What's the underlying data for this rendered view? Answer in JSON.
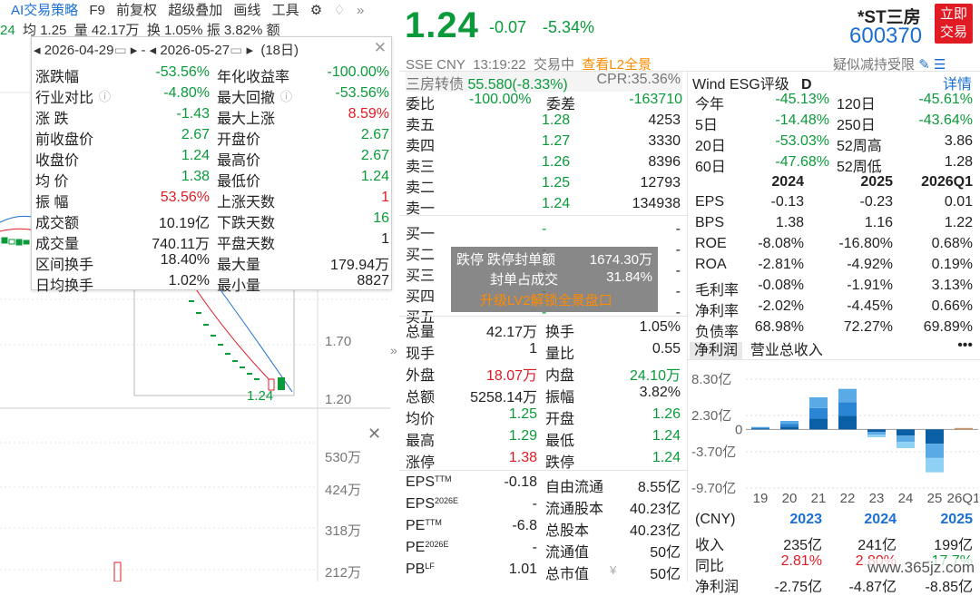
{
  "toolbar": {
    "ai_label": "AI交易策略",
    "f9": "F9",
    "prev_adj": "前复权",
    "overlay": "超级叠加",
    "draw": "画线",
    "tools": "工具"
  },
  "ticker_strip": {
    "price_prefix": "24",
    "avg": "均 1.25",
    "vol": "量 42.17万",
    "turnover": "换 1.05%",
    "amp": "振 3.82%",
    "amt": "额"
  },
  "range_popup": {
    "start": "2026-04-29",
    "end": "2026-05-27",
    "days": "(18日)",
    "rows": [
      {
        "l1": "涨跌幅",
        "v1": "-53.56%",
        "c1": "green",
        "l2": "年化收益率",
        "v2": "-100.00%",
        "c2": "green",
        "h1": false,
        "h2": false
      },
      {
        "l1": "行业对比",
        "v1": "-4.80%",
        "c1": "green",
        "l2": "最大回撤",
        "v2": "-53.56%",
        "c2": "green",
        "h1": true,
        "h2": true
      },
      {
        "l1": "涨  跌",
        "v1": "-1.43",
        "c1": "green",
        "l2": "最大上涨",
        "v2": "8.59%",
        "c2": "red",
        "h1": false,
        "h2": false
      },
      {
        "l1": "前收盘价",
        "v1": "2.67",
        "c1": "green",
        "l2": "开盘价",
        "v2": "2.67",
        "c2": "green",
        "h1": false,
        "h2": false
      },
      {
        "l1": "收盘价",
        "v1": "1.24",
        "c1": "green",
        "l2": "最高价",
        "v2": "2.67",
        "c2": "green",
        "h1": false,
        "h2": false
      },
      {
        "l1": "均  价",
        "v1": "1.38",
        "c1": "green",
        "l2": "最低价",
        "v2": "1.24",
        "c2": "green",
        "h1": false,
        "h2": false
      },
      {
        "l1": "振  幅",
        "v1": "53.56%",
        "c1": "red",
        "l2": "上涨天数",
        "v2": "1",
        "c2": "red",
        "h1": false,
        "h2": false
      },
      {
        "l1": "成交额",
        "v1": "10.19亿",
        "c1": "black",
        "l2": "下跌天数",
        "v2": "16",
        "c2": "green",
        "h1": false,
        "h2": false
      },
      {
        "l1": "成交量",
        "v1": "740.11万",
        "c1": "black",
        "l2": "平盘天数",
        "v2": "1",
        "c2": "black",
        "h1": false,
        "h2": false
      },
      {
        "l1": "区间换手",
        "v1": "18.40%",
        "c1": "black",
        "l2": "最大量",
        "v2": "179.94万",
        "c2": "black",
        "h1": false,
        "h2": false
      },
      {
        "l1": "日均换手",
        "v1": "1.02%",
        "c1": "black",
        "l2": "最小量",
        "v2": "8827",
        "c2": "black",
        "h1": false,
        "h2": false
      }
    ]
  },
  "chart": {
    "price_ticks": [
      "1.70",
      "1.20"
    ],
    "last_label": "1.24",
    "vol_ticks": [
      "530万",
      "424万",
      "318万",
      "212万"
    ]
  },
  "quote": {
    "price": "1.24",
    "change": "-0.07",
    "pct": "-5.34%",
    "name": "*ST三房",
    "code": "600370",
    "trade_btn": "立即交易",
    "exchange": "SSE  CNY",
    "time": "13:19:22",
    "status": "交易中",
    "l2_link": "查看L2全景",
    "risk": "疑似减持受限"
  },
  "convert": {
    "label": "三房转债",
    "price": "55.580(-8.33%)",
    "cpr": "CPR:35.36%"
  },
  "orderbook": {
    "wb_label": "委比",
    "wb": "-100.00%",
    "wc_label": "委差",
    "wc": "-163710",
    "asks": [
      {
        "l": "卖五",
        "p": "1.28",
        "v": "4253"
      },
      {
        "l": "卖四",
        "p": "1.27",
        "v": "3330"
      },
      {
        "l": "卖三",
        "p": "1.26",
        "v": "8396"
      },
      {
        "l": "卖二",
        "p": "1.25",
        "v": "12793"
      },
      {
        "l": "卖一",
        "p": "1.24",
        "v": "134938"
      }
    ],
    "bids": [
      {
        "l": "买一",
        "p": "-",
        "v": "-"
      },
      {
        "l": "买二",
        "p": "-",
        "v": "-"
      },
      {
        "l": "买三",
        "p": "-",
        "v": "-"
      },
      {
        "l": "买四",
        "p": "-",
        "v": "-"
      },
      {
        "l": "买五",
        "p": "-",
        "v": "-"
      }
    ],
    "overlay": {
      "l1": "跌停",
      "l2": "跌停封单额",
      "v2": "1674.30万",
      "l3": "封单占成交",
      "v3": "31.84%",
      "upgrade": "升级LV2解锁全景盘口"
    }
  },
  "stats": [
    {
      "l1": "总量",
      "v1": "42.17万",
      "c1": "black",
      "l2": "换手",
      "v2": "1.05%",
      "c2": "black"
    },
    {
      "l1": "现手",
      "v1": "1",
      "c1": "black",
      "l2": "量比",
      "v2": "0.55",
      "c2": "black"
    },
    {
      "l1": "外盘",
      "v1": "18.07万",
      "c1": "red",
      "l2": "内盘",
      "v2": "24.10万",
      "c2": "green"
    },
    {
      "l1": "总额",
      "v1": "5258.14万",
      "c1": "black",
      "l2": "振幅",
      "v2": "3.82%",
      "c2": "black"
    },
    {
      "l1": "均价",
      "v1": "1.25",
      "c1": "green",
      "l2": "开盘",
      "v2": "1.26",
      "c2": "green"
    },
    {
      "l1": "最高",
      "v1": "1.29",
      "c1": "green",
      "l2": "最低",
      "v2": "1.24",
      "c2": "green"
    },
    {
      "l1": "涨停",
      "v1": "1.38",
      "c1": "red",
      "l2": "跌停",
      "v2": "1.24",
      "c2": "green"
    }
  ],
  "fund": [
    {
      "l1": "EPS",
      "s1": "TTM",
      "v1": "-0.18",
      "l2": "自由流通",
      "v2": "8.55亿"
    },
    {
      "l1": "EPS",
      "s1": "2026E",
      "v1": "-",
      "l2": "流通股本",
      "v2": "40.23亿"
    },
    {
      "l1": "PE",
      "s1": "TTM",
      "v1": "-6.8",
      "l2": "总股本",
      "v2": "40.23亿"
    },
    {
      "l1": "PE",
      "s1": "2026E",
      "v1": "-",
      "l2": "流通值",
      "v2": "50亿"
    },
    {
      "l1": "PB",
      "s1": "LF",
      "v1": "1.01",
      "l2": "总市值",
      "v2": "50亿"
    }
  ],
  "esg": {
    "label": "Wind ESG评级",
    "grade": "D",
    "detail": "详情"
  },
  "perf": [
    {
      "l1": "今年",
      "v1": "-45.13%",
      "l2": "120日",
      "v2": "-45.61%"
    },
    {
      "l1": "5日",
      "v1": "-14.48%",
      "l2": "250日",
      "v2": "-43.64%"
    },
    {
      "l1": "20日",
      "v1": "-53.03%",
      "l2": "52周高",
      "v2": "3.86"
    },
    {
      "l1": "60日",
      "v1": "-47.68%",
      "l2": "52周低",
      "v2": "1.28"
    }
  ],
  "fin_header": [
    "2024",
    "2025",
    "2026Q1"
  ],
  "fin_rows": [
    {
      "l": "EPS",
      "v": [
        "-0.13",
        "-0.23",
        "0.01"
      ]
    },
    {
      "l": "BPS",
      "v": [
        "1.38",
        "1.16",
        "1.22"
      ]
    },
    {
      "l": "ROE",
      "v": [
        "-8.08%",
        "-16.80%",
        "0.68%"
      ]
    },
    {
      "l": "ROA",
      "v": [
        "-2.81%",
        "-4.92%",
        "0.19%"
      ]
    },
    {
      "l": "毛利率",
      "v": [
        "-0.08%",
        "-1.91%",
        "3.13%"
      ]
    },
    {
      "l": "净利率",
      "v": [
        "-2.02%",
        "-4.45%",
        "0.66%"
      ]
    },
    {
      "l": "负债率",
      "v": [
        "68.98%",
        "72.27%",
        "69.89%"
      ]
    }
  ],
  "tabs": {
    "t1": "净利润",
    "t2": "营业总收入",
    "more": "•••"
  },
  "chart_data": {
    "type": "bar",
    "ylabel_ticks": [
      "8.30亿",
      "2.30亿",
      "0",
      "-3.70亿",
      "-9.70亿"
    ],
    "ylim": [
      -9.7,
      8.3
    ],
    "categories": [
      "19",
      "20",
      "21",
      "22",
      "23",
      "24",
      "25",
      "26Q1"
    ],
    "values": [
      0.4,
      1.4,
      5.3,
      6.7,
      -1.3,
      -3.1,
      -7.1,
      0.05
    ]
  },
  "bottom_table": {
    "unit": "(CNY)",
    "years": [
      "2023",
      "2024",
      "2025"
    ],
    "rows": [
      {
        "l": "收入",
        "v": [
          "235亿",
          "241亿",
          "199亿"
        ]
      },
      {
        "l": "同比",
        "v": [
          "2.81%",
          "2.80%",
          "-17.7%"
        ]
      },
      {
        "l": "净利润",
        "v": [
          "-2.75亿",
          "-4.87亿",
          "-8.85亿"
        ]
      }
    ]
  },
  "watermark": "www.365jz.com"
}
